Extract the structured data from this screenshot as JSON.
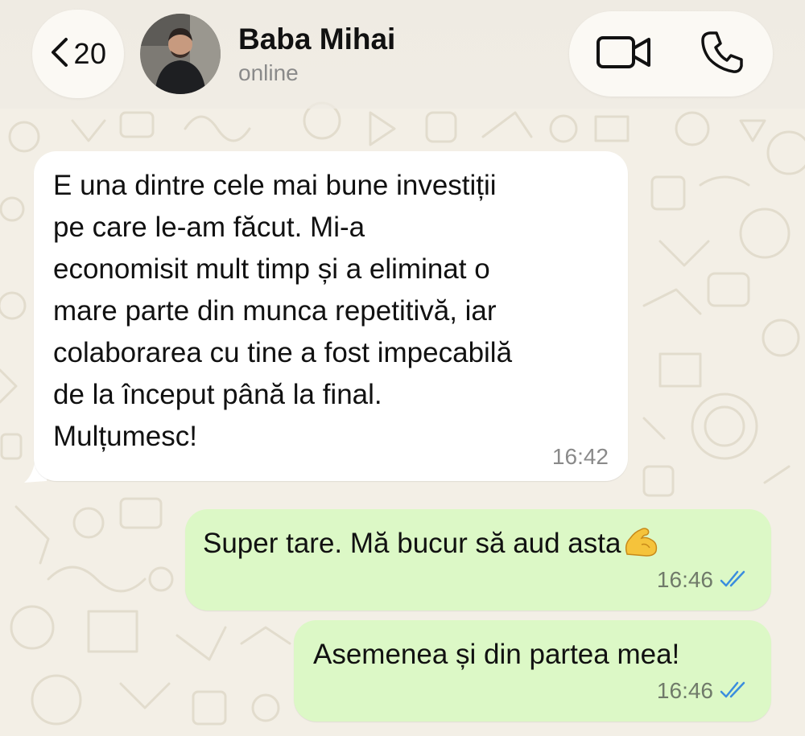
{
  "header": {
    "back_count": "20",
    "contact_name": "Baba Mihai",
    "contact_status": "online"
  },
  "icons": {
    "back": "chevron-left-icon",
    "video": "video-camera-icon",
    "call": "phone-icon",
    "read_receipt": "double-check-icon",
    "emoji": "flexed-biceps-emoji"
  },
  "colors": {
    "incoming_bubble": "#ffffff",
    "outgoing_bubble": "#dcf8c6",
    "read_receipt": "#3a8dde",
    "wallpaper": "#f3efe6"
  },
  "messages": [
    {
      "direction": "incoming",
      "text": "E una dintre cele mai bune investiții\npe care le-am făcut. Mi-a\neconomisit mult timp și a eliminat o\nmare parte din munca repetitivă, iar\ncolaborarea cu tine a fost impecabilă\nde la început până la final.\nMulțumesc!",
      "time": "16:42"
    },
    {
      "direction": "outgoing",
      "text": "Super tare. Mă bucur să aud asta",
      "emoji": "💪",
      "time": "16:46",
      "status": "read"
    },
    {
      "direction": "outgoing",
      "text": "Asemenea și din partea mea!",
      "time": "16:46",
      "status": "read"
    }
  ]
}
